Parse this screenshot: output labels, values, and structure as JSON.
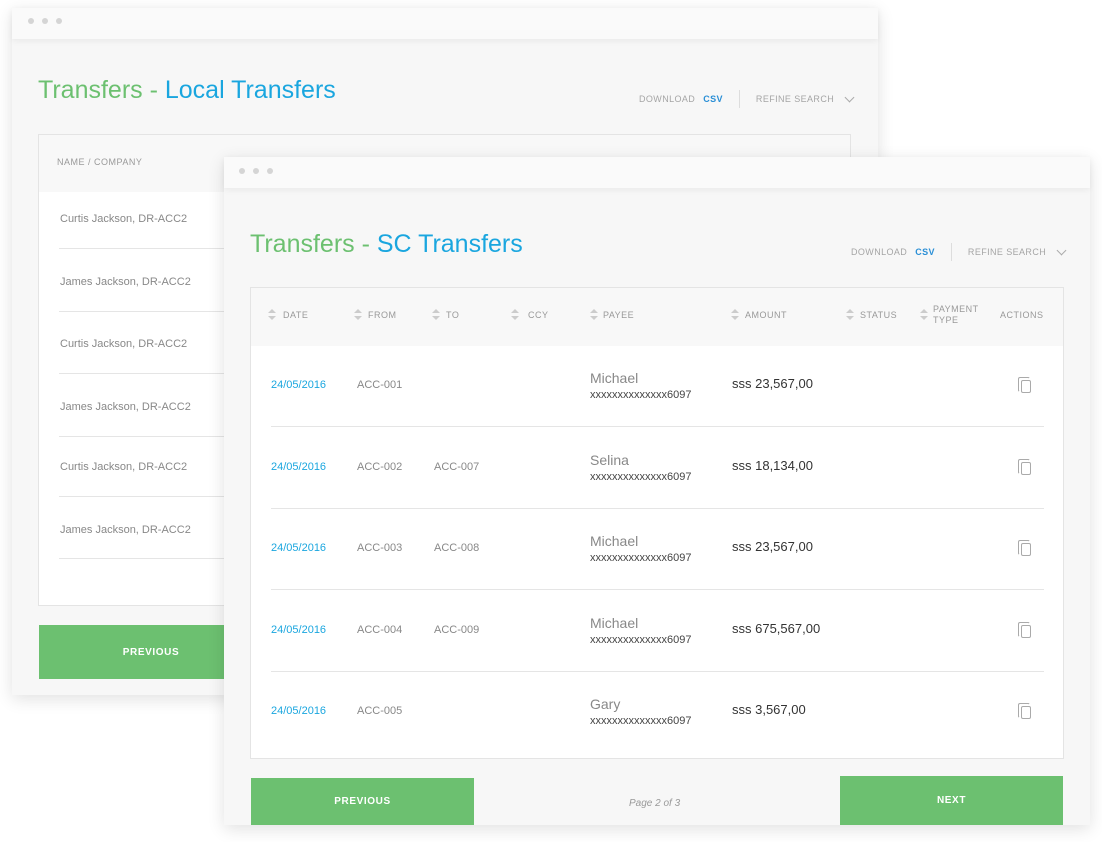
{
  "back": {
    "title_prefix": "Transfers - ",
    "title_main": "Local Transfers",
    "download": "DOWNLOAD",
    "csv": "CSV",
    "refine": "REFINE SEARCH",
    "col_name": "NAME / COMPANY",
    "rows": [
      "Curtis Jackson, DR-ACC2",
      "James Jackson, DR-ACC2",
      "Curtis Jackson, DR-ACC2",
      "James Jackson, DR-ACC2",
      "Curtis Jackson, DR-ACC2",
      "James Jackson, DR-ACC2"
    ],
    "previous": "PREVIOUS"
  },
  "front": {
    "title_prefix": "Transfers - ",
    "title_main": "SC Transfers",
    "download": "DOWNLOAD",
    "csv": "CSV",
    "refine": "REFINE SEARCH",
    "columns": [
      "DATE",
      "FROM",
      "TO",
      "CCY",
      "PAYEE",
      "AMOUNT",
      "STATUS",
      "PAYMENT TYPE",
      "ACTIONS"
    ],
    "rows": [
      {
        "date": "24/05/2016",
        "from": "ACC-001",
        "to": "",
        "payee": "Michael",
        "account": "xxxxxxxxxxxxxx6097",
        "amount": "sss 23,567,00"
      },
      {
        "date": "24/05/2016",
        "from": "ACC-002",
        "to": "ACC-007",
        "payee": "Selina",
        "account": "xxxxxxxxxxxxxx6097",
        "amount": "sss 18,134,00"
      },
      {
        "date": "24/05/2016",
        "from": "ACC-003",
        "to": "ACC-008",
        "payee": "Michael",
        "account": "xxxxxxxxxxxxxx6097",
        "amount": "sss 23,567,00"
      },
      {
        "date": "24/05/2016",
        "from": "ACC-004",
        "to": "ACC-009",
        "payee": "Michael",
        "account": "xxxxxxxxxxxxxx6097",
        "amount": "sss 675,567,00"
      },
      {
        "date": "24/05/2016",
        "from": "ACC-005",
        "to": "",
        "payee": "Gary",
        "account": "xxxxxxxxxxxxxx6097",
        "amount": "sss 3,567,00"
      }
    ],
    "previous": "PREVIOUS",
    "page": "Page 2 of 3",
    "next": "NEXT"
  },
  "colors": {
    "green": "#6cc070",
    "blue": "#1aa6df"
  }
}
